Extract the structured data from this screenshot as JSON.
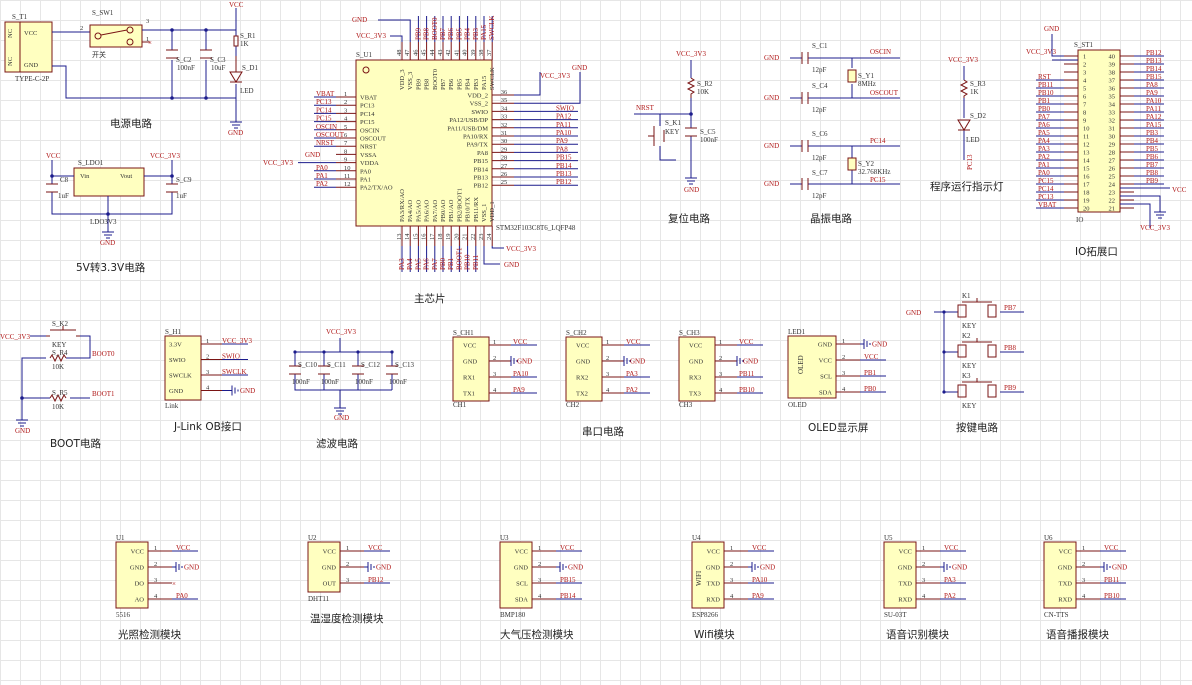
{
  "captions": {
    "power": "电源电路",
    "ldo": "5V转3.3V电路",
    "mcu": "主芯片",
    "reset": "复位电路",
    "crystal": "晶振电路",
    "led": "程序运行指示灯",
    "io": "IO拓展口",
    "boot": "BOOT电路",
    "jlink": "J-Link OB接口",
    "filter": "滤波电路",
    "serial": "串口电路",
    "oled": "OLED显示屏",
    "keys": "按键电路",
    "light": "光照检测模块",
    "dht": "温湿度检测模块",
    "bmp": "大气压检测模块",
    "wifi": "Wifi模块",
    "voice_rec": "语音识别模块",
    "voice_tts": "语音播报模块"
  },
  "power": {
    "t1_ref": "S_T1",
    "t1_part": "TYPE-C-2P",
    "t1_pins": [
      "NC",
      "VCC",
      "NC",
      "GND"
    ],
    "sw_ref": "S_SW1",
    "sw_label": "开关",
    "c2": "S_C2",
    "c2v": "100nF",
    "c3": "S_C3",
    "c3v": "10uF",
    "r1": "S_R1",
    "r1v": "1K",
    "d1": "S_D1",
    "d1v": "LED",
    "vcc": "VCC",
    "gnd": "GND"
  },
  "ldo": {
    "ref": "S_LDO1",
    "part": "LDO3V3",
    "vin": "Vin",
    "vout": "Vout",
    "c8": "C8",
    "c8v": "1uF",
    "c9": "S_C9",
    "c9v": "1uF",
    "vcc": "VCC",
    "out": "VCC_3V3",
    "gnd": "GND"
  },
  "mcu": {
    "ref": "S_U1",
    "part": "STM32F103C8T6_LQFP48",
    "left_pins": [
      {
        "num": "1",
        "name": "VBAT",
        "net": "VBAT"
      },
      {
        "num": "2",
        "name": "PC13",
        "net": "PC13"
      },
      {
        "num": "3",
        "name": "PC14",
        "net": "PC14"
      },
      {
        "num": "4",
        "name": "PC15",
        "net": "PC15"
      },
      {
        "num": "5",
        "name": "OSCIN",
        "net": "OSCIN"
      },
      {
        "num": "6",
        "name": "OSCOUT",
        "net": "OSCOUT"
      },
      {
        "num": "7",
        "name": "NRST",
        "net": "NRST"
      },
      {
        "num": "8",
        "name": "VSSA",
        "net": "GND"
      },
      {
        "num": "9",
        "name": "VDDA",
        "net": "VCC_3V3"
      },
      {
        "num": "10",
        "name": "PA0",
        "net": "PA0"
      },
      {
        "num": "11",
        "name": "PA1",
        "net": "PA1"
      },
      {
        "num": "12",
        "name": "PA2/TX/AO",
        "net": "PA2"
      }
    ],
    "right_pins": [
      {
        "num": "36",
        "name": "VDD_2",
        "net": "VCC_3V3"
      },
      {
        "num": "35",
        "name": "VSS_2",
        "net": "GND"
      },
      {
        "num": "34",
        "name": "SWIO",
        "net": "SWIO"
      },
      {
        "num": "33",
        "name": "PA12/USB/DP",
        "net": "PA12"
      },
      {
        "num": "32",
        "name": "PA11/USB/DM",
        "net": "PA11"
      },
      {
        "num": "31",
        "name": "PA10/RX",
        "net": "PA10"
      },
      {
        "num": "30",
        "name": "PA9/TX",
        "net": "PA9"
      },
      {
        "num": "29",
        "name": "PA8",
        "net": "PA8"
      },
      {
        "num": "28",
        "name": "PB15",
        "net": "PB15"
      },
      {
        "num": "27",
        "name": "PB14",
        "net": "PB14"
      },
      {
        "num": "26",
        "name": "PB13",
        "net": "PB13"
      },
      {
        "num": "25",
        "name": "PB12",
        "net": "PB12"
      }
    ],
    "top_pins": [
      {
        "num": "48",
        "name": "VDD_3",
        "net": "VCC_3V3"
      },
      {
        "num": "47",
        "name": "VSS_3",
        "net": "GND"
      },
      {
        "num": "46",
        "name": "PB9",
        "net": "PB9"
      },
      {
        "num": "45",
        "name": "PB8",
        "net": "PB8"
      },
      {
        "num": "44",
        "name": "BOOT0",
        "net": "BOOT0"
      },
      {
        "num": "43",
        "name": "PB7",
        "net": "PB7"
      },
      {
        "num": "42",
        "name": "PB6",
        "net": "PB6"
      },
      {
        "num": "41",
        "name": "PB5",
        "net": "PB5"
      },
      {
        "num": "40",
        "name": "PB4",
        "net": "PB4"
      },
      {
        "num": "39",
        "name": "PB3",
        "net": "PB3"
      },
      {
        "num": "38",
        "name": "PA15",
        "net": "PA15"
      },
      {
        "num": "37",
        "name": "SWCLK",
        "net": "SWCLK"
      }
    ],
    "bottom_pins": [
      {
        "num": "13",
        "name": "PA3/RX/AO",
        "net": "PA3"
      },
      {
        "num": "14",
        "name": "PA4/AO",
        "net": "PA4"
      },
      {
        "num": "15",
        "name": "PA5/AO",
        "net": "PA5"
      },
      {
        "num": "16",
        "name": "PA6/AO",
        "net": "PA6"
      },
      {
        "num": "17",
        "name": "PA7/AO",
        "net": "PA7"
      },
      {
        "num": "18",
        "name": "PB0/AO",
        "net": "PB0"
      },
      {
        "num": "19",
        "name": "PB1/AO",
        "net": "PB1"
      },
      {
        "num": "20",
        "name": "PB2/BOOT1",
        "net": "BOOT1"
      },
      {
        "num": "21",
        "name": "PB10/TX",
        "net": "PB10"
      },
      {
        "num": "22",
        "name": "PB11/RX",
        "net": "PB11"
      },
      {
        "num": "23",
        "name": "VSS_1",
        "net": "GND"
      },
      {
        "num": "24",
        "name": "VDD_1",
        "net": "VCC_3V3"
      }
    ],
    "gnd": "GND",
    "vcc": "VCC_3V3"
  },
  "reset": {
    "vcc": "VCC_3V3",
    "r2": "S_R2",
    "r2v": "10K",
    "nrst": "NRST",
    "k1": "S_K1",
    "k1v": "KEY",
    "c5": "S_C5",
    "c5v": "100nF",
    "gnd": "GND"
  },
  "crystal": {
    "c1": "S_C1",
    "c4": "S_C4",
    "c6": "S_C6",
    "c7": "S_C7",
    "cv": "12pF",
    "y1": "S_Y1",
    "y1v": "8MHz",
    "y2": "S_Y2",
    "y2v": "32.768KHz",
    "oscin": "OSCIN",
    "oscout": "OSCOUT",
    "pc14": "PC14",
    "pc15": "PC15",
    "gnd": "GND"
  },
  "led": {
    "vcc": "VCC_3V3",
    "r3": "S_R3",
    "r3v": "1K",
    "d2": "S_D2",
    "d2v": "LED",
    "net": "PC13"
  },
  "io": {
    "ref": "S_ST1",
    "part": "IO",
    "vcc": "VCC_3V3",
    "gnd": "GND",
    "vcc5": "VCC",
    "rows": [
      {
        "ln": "",
        "l": "1",
        "r": "40",
        "rn": "PB12"
      },
      {
        "ln": "",
        "l": "2",
        "r": "39",
        "rn": "PB13"
      },
      {
        "ln": "",
        "l": "3",
        "r": "38",
        "rn": "PB14"
      },
      {
        "ln": "RST",
        "l": "4",
        "r": "37",
        "rn": "PB15"
      },
      {
        "ln": "PB11",
        "l": "5",
        "r": "36",
        "rn": "PA8"
      },
      {
        "ln": "PB10",
        "l": "6",
        "r": "35",
        "rn": "PA9"
      },
      {
        "ln": "PB1",
        "l": "7",
        "r": "34",
        "rn": "PA10"
      },
      {
        "ln": "PB0",
        "l": "8",
        "r": "33",
        "rn": "PA11"
      },
      {
        "ln": "PA7",
        "l": "9",
        "r": "32",
        "rn": "PA12"
      },
      {
        "ln": "PA6",
        "l": "10",
        "r": "31",
        "rn": "PA15"
      },
      {
        "ln": "PA5",
        "l": "11",
        "r": "30",
        "rn": "PB3"
      },
      {
        "ln": "PA4",
        "l": "12",
        "r": "29",
        "rn": "PB4"
      },
      {
        "ln": "PA3",
        "l": "13",
        "r": "28",
        "rn": "PB5"
      },
      {
        "ln": "PA2",
        "l": "14",
        "r": "27",
        "rn": "PB6"
      },
      {
        "ln": "PA1",
        "l": "15",
        "r": "26",
        "rn": "PB7"
      },
      {
        "ln": "PA0",
        "l": "16",
        "r": "25",
        "rn": "PB8"
      },
      {
        "ln": "PC15",
        "l": "17",
        "r": "24",
        "rn": "PB9"
      },
      {
        "ln": "PC14",
        "l": "18",
        "r": "23",
        "rn": ""
      },
      {
        "ln": "PC13",
        "l": "19",
        "r": "22",
        "rn": ""
      },
      {
        "ln": "VBAT",
        "l": "20",
        "r": "21",
        "rn": ""
      }
    ]
  },
  "boot": {
    "vcc": "VCC_3V3",
    "k2": "S_K2",
    "k2v": "KEY",
    "r4": "S_R4",
    "r4v": "10K",
    "r5": "S_R5",
    "r5v": "10K",
    "boot0": "BOOT0",
    "boot1": "BOOT1",
    "gnd": "GND"
  },
  "jlink": {
    "ref": "S_H1",
    "part": "Link",
    "pins": [
      {
        "n": "1",
        "name": "3.3V",
        "net": "VCC_3V3"
      },
      {
        "n": "2",
        "name": "SWIO",
        "net": "SWIO"
      },
      {
        "n": "3",
        "name": "SWCLK",
        "net": "SWCLK"
      },
      {
        "n": "4",
        "name": "GND",
        "net": "GND"
      }
    ]
  },
  "filter": {
    "vcc": "VCC_3V3",
    "gnd": "GND",
    "caps": [
      {
        "ref": "S_C10",
        "v": "100nF"
      },
      {
        "ref": "S_C11",
        "v": "100nF"
      },
      {
        "ref": "S_C12",
        "v": "100nF"
      },
      {
        "ref": "S_C13",
        "v": "100nF"
      }
    ]
  },
  "serial": [
    {
      "ref": "S_CH1",
      "part": "CH1",
      "rx": "PA10",
      "tx": "PA9"
    },
    {
      "ref": "S_CH2",
      "part": "CH2",
      "rx": "PA3",
      "tx": "PA2"
    },
    {
      "ref": "S_CH3",
      "part": "CH3",
      "rx": "PB11",
      "tx": "PB10"
    }
  ],
  "serial_pins": [
    "VCC",
    "GND",
    "RX1",
    "TX1",
    "RX2",
    "TX2",
    "RX3",
    "TX3"
  ],
  "oled": {
    "ref": "LED1",
    "part": "OLED",
    "body": "OLED",
    "pins": [
      "GND",
      "VCC",
      "SCL",
      "SDA"
    ],
    "nets": [
      "GND",
      "VCC",
      "PB1",
      "PB0"
    ]
  },
  "keys": [
    {
      "ref": "K1",
      "v": "KEY",
      "net": "PB7"
    },
    {
      "ref": "K2",
      "v": "KEY",
      "net": "PB8"
    },
    {
      "ref": "K3",
      "v": "KEY",
      "net": "PB9"
    }
  ],
  "keys_gnd": "GND",
  "modules": [
    {
      "ref": "U1",
      "part": "5516",
      "pins": [
        "VCC",
        "GND",
        "DO",
        "AO"
      ],
      "nets": [
        "VCC",
        "GND",
        "",
        "PA0"
      ],
      "body": ""
    },
    {
      "ref": "U2",
      "part": "DHT11",
      "pins": [
        "VCC",
        "GND",
        "OUT"
      ],
      "nets": [
        "VCC",
        "GND",
        "PB12"
      ],
      "body": ""
    },
    {
      "ref": "U3",
      "part": "BMP180",
      "pins": [
        "VCC",
        "GND",
        "SCL",
        "SDA"
      ],
      "nets": [
        "VCC",
        "GND",
        "PB15",
        "PB14"
      ],
      "body": ""
    },
    {
      "ref": "U4",
      "part": "ESP8266",
      "pins": [
        "VCC",
        "GND",
        "TXD",
        "RXD"
      ],
      "nets": [
        "VCC",
        "GND",
        "PA10",
        "PA9"
      ],
      "body": "WIFI"
    },
    {
      "ref": "U5",
      "part": "SU-03T",
      "pins": [
        "VCC",
        "GND",
        "TXD",
        "RXD"
      ],
      "nets": [
        "VCC",
        "GND",
        "PA3",
        "PA2"
      ],
      "body": ""
    },
    {
      "ref": "U6",
      "part": "CN-TTS",
      "pins": [
        "VCC",
        "GND",
        "TXD",
        "RXD"
      ],
      "nets": [
        "VCC",
        "GND",
        "PB11",
        "PB10"
      ],
      "body": ""
    }
  ]
}
